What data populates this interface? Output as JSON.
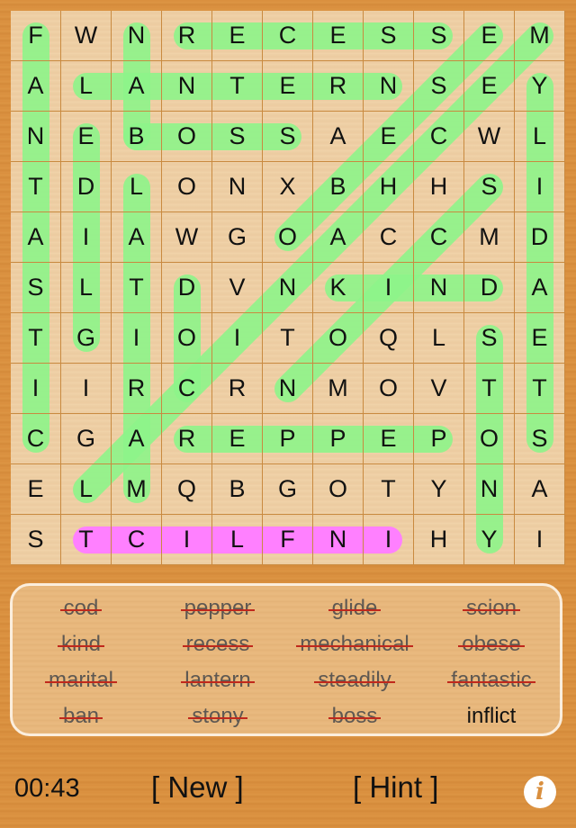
{
  "grid": [
    [
      "F",
      "W",
      "N",
      "R",
      "E",
      "C",
      "E",
      "S",
      "S",
      "E",
      "M"
    ],
    [
      "A",
      "L",
      "A",
      "N",
      "T",
      "E",
      "R",
      "N",
      "S",
      "E",
      "Y"
    ],
    [
      "N",
      "E",
      "B",
      "O",
      "S",
      "S",
      "A",
      "E",
      "C",
      "W",
      "L"
    ],
    [
      "T",
      "D",
      "L",
      "O",
      "N",
      "X",
      "B",
      "H",
      "H",
      "S",
      "I"
    ],
    [
      "A",
      "I",
      "A",
      "W",
      "G",
      "O",
      "A",
      "C",
      "C",
      "M",
      "D"
    ],
    [
      "S",
      "L",
      "T",
      "D",
      "V",
      "N",
      "K",
      "I",
      "N",
      "D",
      "A"
    ],
    [
      "T",
      "G",
      "I",
      "O",
      "I",
      "T",
      "O",
      "Q",
      "L",
      "S",
      "E"
    ],
    [
      "I",
      "I",
      "R",
      "C",
      "R",
      "N",
      "M",
      "O",
      "V",
      "T",
      "T"
    ],
    [
      "C",
      "G",
      "A",
      "R",
      "E",
      "P",
      "P",
      "E",
      "P",
      "O",
      "S"
    ],
    [
      "E",
      "L",
      "M",
      "Q",
      "B",
      "G",
      "O",
      "T",
      "Y",
      "N",
      "A"
    ],
    [
      "S",
      "T",
      "C",
      "I",
      "L",
      "F",
      "N",
      "I",
      "H",
      "Y",
      "I"
    ]
  ],
  "colors": {
    "found": "#8ef58a",
    "hint": "#ff80ff"
  },
  "placements": [
    {
      "word": "recess",
      "from": [
        0,
        3
      ],
      "to": [
        0,
        8
      ],
      "state": "found"
    },
    {
      "word": "lantern",
      "from": [
        1,
        1
      ],
      "to": [
        1,
        7
      ],
      "state": "found"
    },
    {
      "word": "boss",
      "from": [
        2,
        2
      ],
      "to": [
        2,
        5
      ],
      "state": "found"
    },
    {
      "word": "kind",
      "from": [
        5,
        6
      ],
      "to": [
        5,
        9
      ],
      "state": "found"
    },
    {
      "word": "pepper",
      "from": [
        8,
        8
      ],
      "to": [
        8,
        3
      ],
      "state": "found"
    },
    {
      "word": "fantastic",
      "from": [
        0,
        0
      ],
      "to": [
        8,
        0
      ],
      "state": "found"
    },
    {
      "word": "glide",
      "from": [
        6,
        1
      ],
      "to": [
        2,
        1
      ],
      "state": "found"
    },
    {
      "word": "ban",
      "from": [
        2,
        2
      ],
      "to": [
        0,
        2
      ],
      "state": "found"
    },
    {
      "word": "marital",
      "from": [
        9,
        2
      ],
      "to": [
        3,
        2
      ],
      "state": "found"
    },
    {
      "word": "cod",
      "from": [
        7,
        3
      ],
      "to": [
        5,
        3
      ],
      "state": "found"
    },
    {
      "word": "steadily",
      "from": [
        8,
        10
      ],
      "to": [
        1,
        10
      ],
      "state": "found"
    },
    {
      "word": "stony",
      "from": [
        6,
        9
      ],
      "to": [
        10,
        9
      ],
      "state": "found"
    },
    {
      "word": "scion",
      "from": [
        3,
        9
      ],
      "to": [
        7,
        5
      ],
      "state": "found"
    },
    {
      "word": "mechanical",
      "from": [
        0,
        10
      ],
      "to": [
        9,
        1
      ],
      "state": "found"
    },
    {
      "word": "obese",
      "from": [
        4,
        5
      ],
      "to": [
        0,
        9
      ],
      "state": "found"
    },
    {
      "word": "inflict",
      "from": [
        10,
        7
      ],
      "to": [
        10,
        1
      ],
      "state": "hint"
    }
  ],
  "word_list": [
    {
      "text": "cod",
      "found": true
    },
    {
      "text": "pepper",
      "found": true
    },
    {
      "text": "glide",
      "found": true
    },
    {
      "text": "scion",
      "found": true
    },
    {
      "text": "kind",
      "found": true
    },
    {
      "text": "recess",
      "found": true
    },
    {
      "text": "mechanical",
      "found": true
    },
    {
      "text": "obese",
      "found": true
    },
    {
      "text": "marital",
      "found": true
    },
    {
      "text": "lantern",
      "found": true
    },
    {
      "text": "steadily",
      "found": true
    },
    {
      "text": "fantastic",
      "found": true
    },
    {
      "text": "ban",
      "found": true
    },
    {
      "text": "stony",
      "found": true
    },
    {
      "text": "boss",
      "found": true
    },
    {
      "text": "inflict",
      "found": false
    }
  ],
  "toolbar": {
    "timer": "00:43",
    "new_label": "[ New ]",
    "hint_label": "[ Hint ]",
    "info_icon": "info-icon",
    "info_glyph": "i"
  }
}
